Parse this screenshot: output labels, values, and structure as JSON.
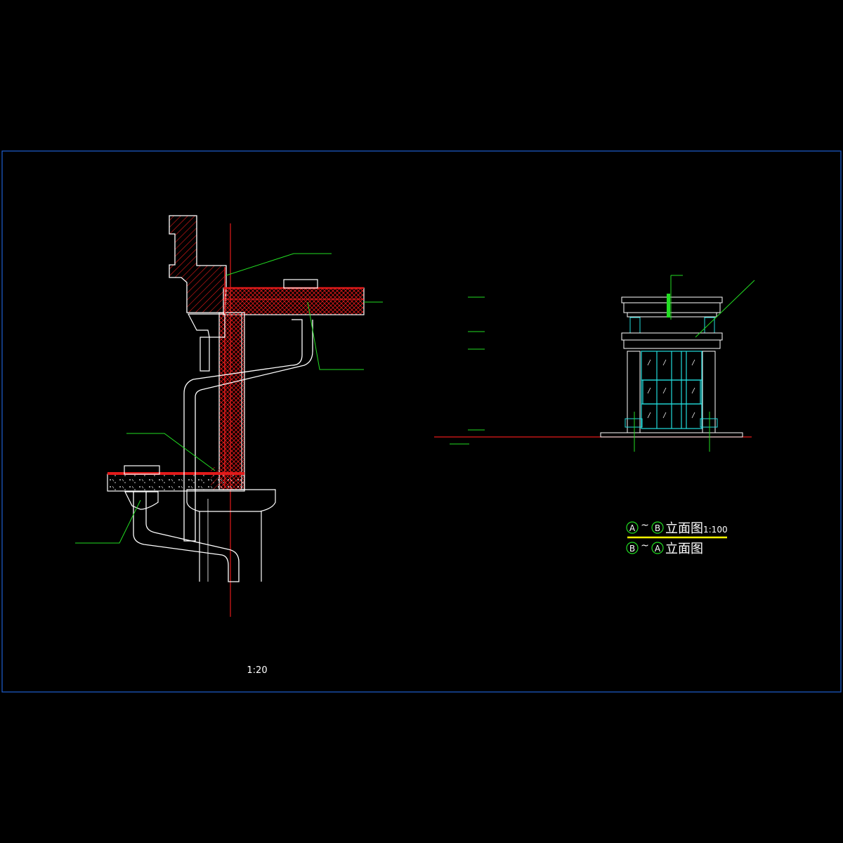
{
  "drawing": {
    "detail_scale": "1:20",
    "elevation_scale": "1:100",
    "title_1": {
      "axis_from": "A",
      "separator": "~",
      "axis_to": "B",
      "label": "立面图"
    },
    "title_2": {
      "axis_from": "B",
      "separator": "~",
      "axis_to": "A",
      "label": "立面图"
    }
  },
  "colors": {
    "background": "#000000",
    "frame": "#1e5fd0",
    "line_white": "#ffffff",
    "line_red": "#e21a1a",
    "leader_green": "#22dd22",
    "cyan": "#22dddd",
    "title_yellow": "#ffff00"
  }
}
